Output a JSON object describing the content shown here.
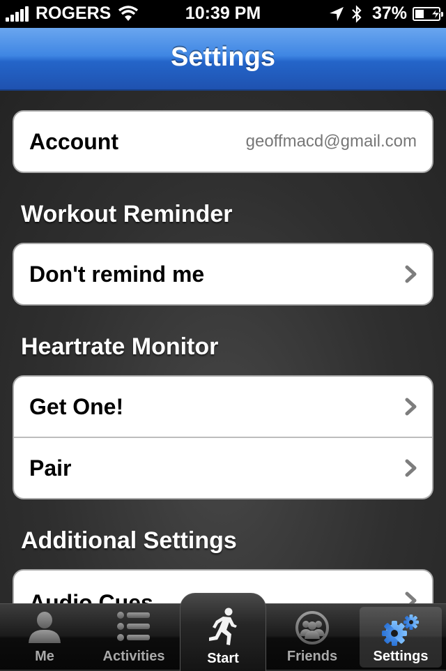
{
  "status_bar": {
    "carrier": "ROGERS",
    "time": "10:39 PM",
    "battery": "37%"
  },
  "nav": {
    "title": "Settings"
  },
  "account": {
    "label": "Account",
    "value": "geoffmacd@gmail.com"
  },
  "workout_reminder": {
    "header": "Workout Reminder",
    "option": "Don't remind me"
  },
  "heartrate_monitor": {
    "header": "Heartrate Monitor",
    "get_one": "Get One!",
    "pair": "Pair"
  },
  "additional_settings": {
    "header": "Additional Settings",
    "audio_cues": "Audio Cues"
  },
  "tabs": [
    {
      "label": "Me",
      "icon": "person-icon"
    },
    {
      "label": "Activities",
      "icon": "list-icon"
    },
    {
      "label": "Start",
      "icon": "runner-icon"
    },
    {
      "label": "Friends",
      "icon": "friends-icon"
    },
    {
      "label": "Settings",
      "icon": "gears-icon",
      "selected": true
    }
  ],
  "colors": {
    "nav_blue": "#3f86e3",
    "selected_tab_icon": "#3b8ee8"
  }
}
